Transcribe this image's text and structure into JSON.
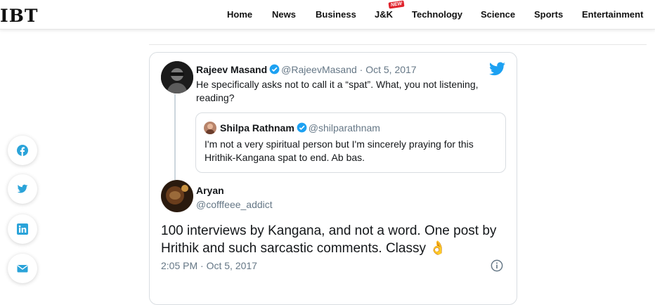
{
  "header": {
    "logo": "IBT",
    "nav": [
      {
        "label": "Home"
      },
      {
        "label": "News"
      },
      {
        "label": "Business"
      },
      {
        "label": "J&K"
      },
      {
        "label": "Technology"
      },
      {
        "label": "Science"
      },
      {
        "label": "Sports"
      },
      {
        "label": "Entertainment"
      }
    ],
    "new_badge": "NEW"
  },
  "share": [
    "facebook-icon",
    "twitter-icon",
    "linkedin-icon",
    "email-icon"
  ],
  "tweet": {
    "author": {
      "name": "Rajeev Masand",
      "handle_time": "@RajeevMasand · Oct 5, 2017"
    },
    "text_line1": "He specifically asks not to call it a “spat”. What, you not listening,",
    "text_line2": "reading?",
    "quoted": {
      "name": "Shilpa Rathnam",
      "handle": "@shilparathnam",
      "text_line1": "I'm not a very spiritual person but I'm sincerely praying for this",
      "text_line2": "Hrithik-Kangana spat to end. Ab bas."
    }
  },
  "reply": {
    "name": "Aryan",
    "handle": "@cofffeee_addict",
    "text_line1": "100 interviews by Kangana, and not a word. One post by",
    "text_line2": "Hrithik and such sarcastic comments. Classy 👌",
    "timestamp": "2:05 PM · Oct 5, 2017"
  },
  "colors": {
    "twitter_blue": "#1da1f2",
    "muted": "#657786",
    "share_icon": "#2aa3d9"
  }
}
